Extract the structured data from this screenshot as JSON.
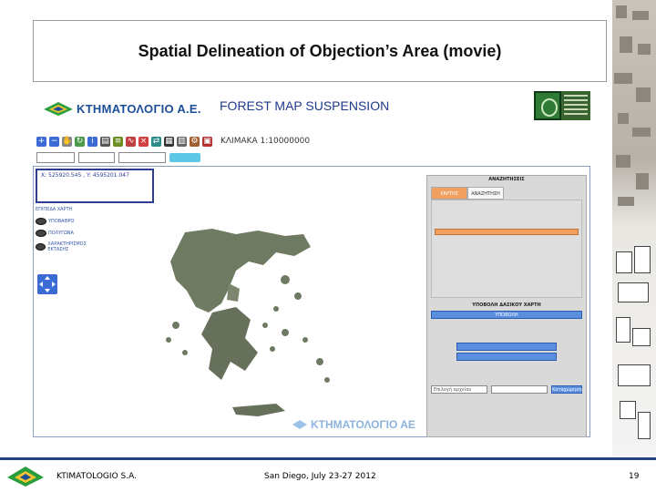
{
  "slide": {
    "title": "Spatial Delineation of Objection’s Area (movie)"
  },
  "app": {
    "logo_text": "ΚΤΗΜΑΤΟΛΟΓΙΟ Α.Ε.",
    "heading": "FOREST MAP SUSPENSION",
    "toolbar": {
      "scale_label": "ΚΛΙΜΑΚΑ 1:10000000",
      "icons": [
        "zoom-in-icon",
        "zoom-out-icon",
        "pan-icon",
        "refresh-icon",
        "info-icon",
        "print-icon",
        "layers-icon",
        "measure-icon",
        "close-icon",
        "export-icon",
        "grid-icon",
        "table-icon",
        "tools-icon",
        "legend-icon"
      ]
    },
    "map": {
      "coords": "X: 525920.545 , Y: 4595201.047",
      "watermark": "ΚΤΗΜΑΤΟΛΟΓΙΟ ΑΕ"
    },
    "layers": {
      "title": "ΕΠΙΠΕΔΑ ΧΑΡΤΗ",
      "items": [
        {
          "label": "ΥΠΟΒΑΘΡΟ"
        },
        {
          "label": "ΠΟΛΥΓΩΝΑ"
        },
        {
          "label": "ΧΑΡΑΚΤΗΡΙΣΜΟΣ ΕΚΤΑΣΗΣ"
        }
      ]
    },
    "panel": {
      "title": "ΑΝΑΖΗΤΗΣΕΙΣ",
      "tab_active": "ΧΑΡΤΗΣ",
      "tab_inactive": "ΑΝΑΖΗΤΗΣΗ",
      "section_title": "ΥΠΟΒΟΛΗ ΔΑΣΙΚΟΥ ΧΑΡΤΗ",
      "submit_label": "ΥΠΟΒΟΛΗ",
      "file_label": "Επιλογή αρχείου",
      "file_value": "",
      "upload_label": "Καταχώρηση"
    }
  },
  "footer": {
    "org": "KTIMATOLOGIO S.A.",
    "event": "San Diego, July 23-27 2012",
    "page": "19"
  },
  "colors": {
    "title_blue": "#1e3a8a",
    "logo_blue": "#1b4e97",
    "footer_bar": "#1f3f87",
    "tab_orange": "#f0a060",
    "button_blue": "#5a8fe0"
  }
}
